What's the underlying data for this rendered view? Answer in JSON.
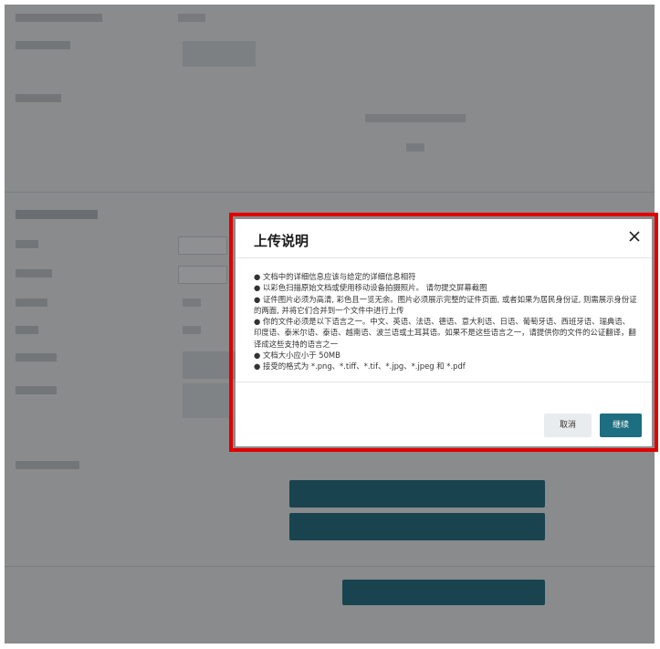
{
  "modal": {
    "title": "上传说明",
    "close_icon": "close-icon",
    "instructions": [
      "● 文档中的详细信息应该与给定的详细信息相符",
      "● 以彩色扫描原始文档或使用移动设备拍摄照片。 请勿提交屏幕截图",
      "● 证件图片必须为高清, 彩色且一览无余。图片必须展示完整的证件页面, 或者如果为居民身份证, 则需展示身份证的两面, 并将它们合并到一个文件中进行上传",
      "● 你的文件必须是以下语言之一。中文、英语、法语、德语、意大利语、日语、葡萄牙语、西班牙语、瑞典语、印度语、泰米尔语、泰语、越南语、波兰语或土耳其语。如果不是这些语言之一，请提供你的文件的公证翻译，翻译成这些支持的语言之一",
      "● 文档大小应小于 50MB",
      "● 接受的格式为 *.png、*.tiff、*.tif、*.jpg、*.jpeg 和 *.pdf"
    ],
    "cancel_label": "取消",
    "continue_label": "继续"
  },
  "colors": {
    "accent": "#1d6e80",
    "highlight_border": "#e00000"
  }
}
